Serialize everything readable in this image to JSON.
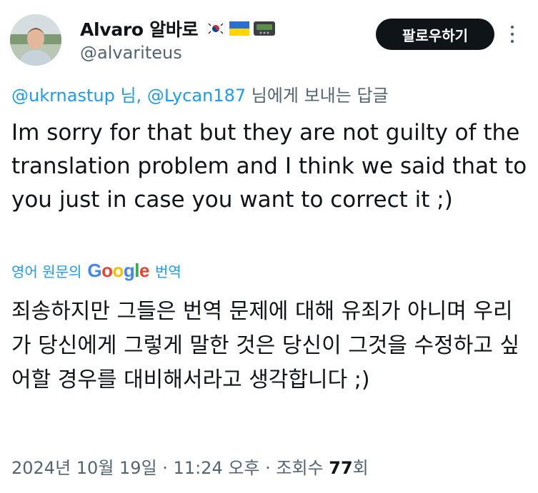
{
  "colors": {
    "text": "#0f1419",
    "secondary": "#536471",
    "accent": "#1d9bf0",
    "button_bg": "#0f1419"
  },
  "author": {
    "display_name": "Alvaro 알바로",
    "handle": "@alvariteus",
    "badges": [
      "south-korea-flag-icon",
      "ukraine-flag-icon",
      "pager-icon"
    ]
  },
  "follow_button": {
    "label": "팔로우하기"
  },
  "reply": {
    "mention1": "@ukrnastup",
    "sep1": " 님, ",
    "mention2": "@Lycan187",
    "suffix": " 님에게 보내는 답글"
  },
  "tweet": {
    "text": "Im sorry for that but they are not guilty of the translation problem and I think we said that to you just in case you want to correct it ;)"
  },
  "translation": {
    "prefix": "영어 원문의",
    "provider": "Google",
    "suffix": "번역",
    "text": "죄송하지만 그들은 번역 문제에 대해 유죄가 아니며 우리가 당신에게 그렇게 말한 것은 당신이 그것을 수정하고 싶어할 경우를 대비해서라고 생각합니다 ;)"
  },
  "meta": {
    "date": "2024년 10월 19일",
    "dot1": " · ",
    "time": "11:24 오후",
    "dot2": " · ",
    "views_label": "조회수 ",
    "views_count": "77",
    "views_unit": "회"
  }
}
